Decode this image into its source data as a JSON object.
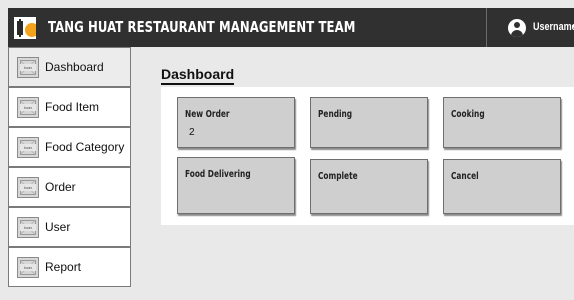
{
  "header": {
    "title": "TANG HUAT RESTAURANT MANAGEMENT TEAM",
    "username": "Username",
    "logo_icon": "restaurant-logo",
    "user_icon": "user-circle-icon"
  },
  "sidebar": {
    "icon_placeholder": "Icon",
    "items": [
      {
        "label": "Dashboard"
      },
      {
        "label": "Food Item"
      },
      {
        "label": "Food Category"
      },
      {
        "label": "Order"
      },
      {
        "label": "User"
      },
      {
        "label": "Report"
      }
    ]
  },
  "main": {
    "title": "Dashboard",
    "cards": [
      {
        "label": "New Order",
        "count": "2"
      },
      {
        "label": "Pending"
      },
      {
        "label": "Cooking"
      },
      {
        "label": "Food Delivering"
      },
      {
        "label": "Complete"
      },
      {
        "label": "Cancel"
      }
    ]
  },
  "colors": {
    "topbar": "#303030",
    "background": "#e9e9e9",
    "card": "#cfcfcf",
    "logo_accent": "#f2a31b"
  }
}
